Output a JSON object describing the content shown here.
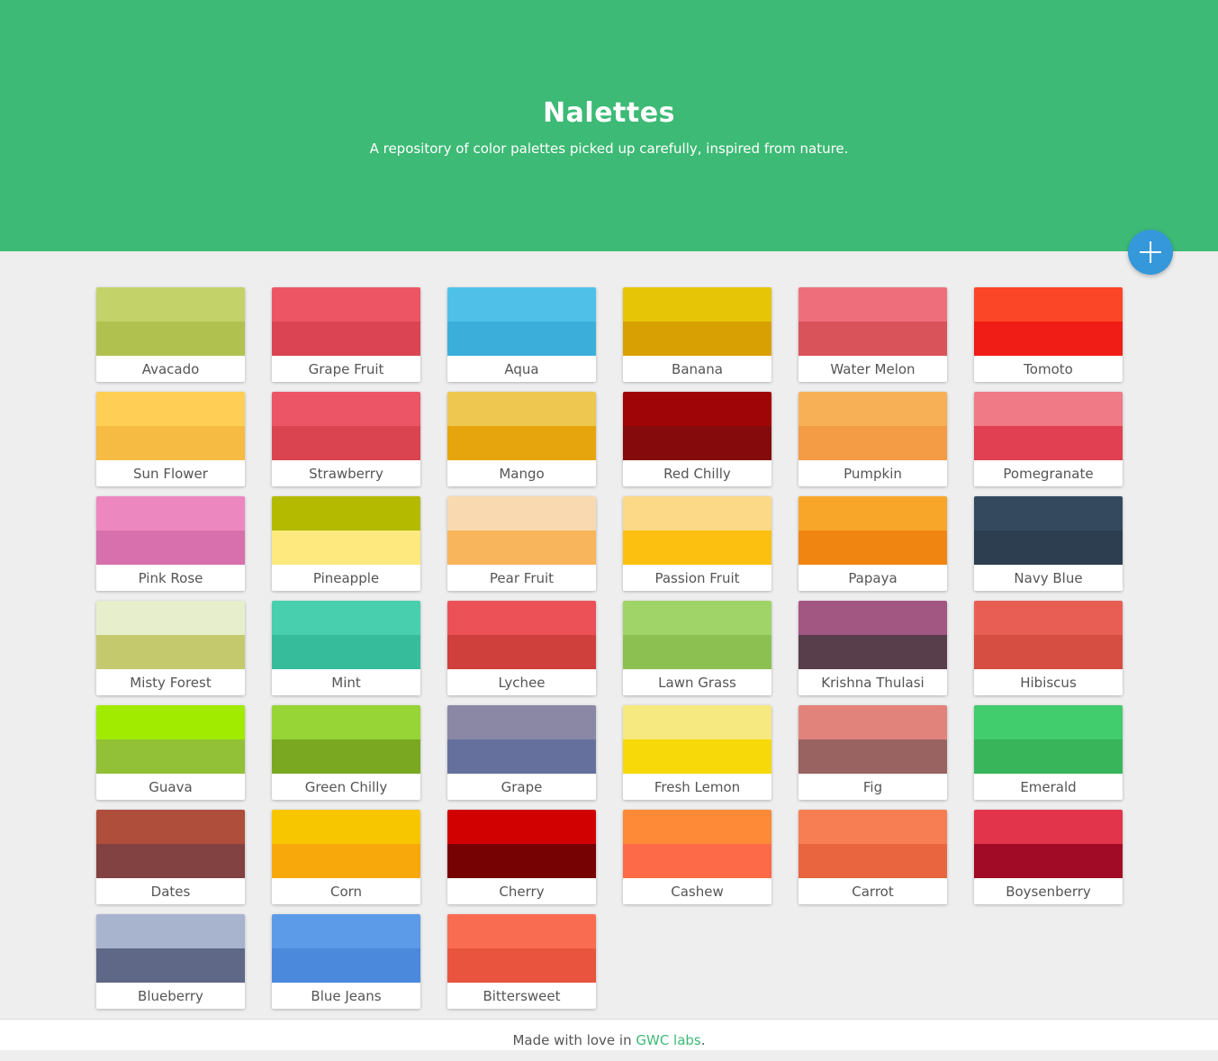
{
  "header": {
    "title": "Nalettes",
    "subtitle": "A repository of color palettes picked up carefully, inspired from nature."
  },
  "colors": {
    "header_bg": "#3dba75",
    "fab_bg": "#3498db",
    "page_bg": "#eeeeee"
  },
  "fab": {
    "icon": "plus-icon"
  },
  "palettes": [
    {
      "name": "Avacado",
      "top": "#c3d369",
      "bottom": "#b1c150"
    },
    {
      "name": "Grape Fruit",
      "top": "#ed5565",
      "bottom": "#da4453"
    },
    {
      "name": "Aqua",
      "top": "#4fc1e9",
      "bottom": "#3bafda"
    },
    {
      "name": "Banana",
      "top": "#e5c505",
      "bottom": "#d9a004"
    },
    {
      "name": "Water Melon",
      "top": "#ee6f7b",
      "bottom": "#d9535a"
    },
    {
      "name": "Tomoto",
      "top": "#fc4628",
      "bottom": "#ef1d16"
    },
    {
      "name": "Sun Flower",
      "top": "#ffce54",
      "bottom": "#f6bb42"
    },
    {
      "name": "Strawberry",
      "top": "#ec5565",
      "bottom": "#da4450"
    },
    {
      "name": "Mango",
      "top": "#eec750",
      "bottom": "#e6a50c"
    },
    {
      "name": "Red Chilly",
      "top": "#9f0407",
      "bottom": "#840a0b"
    },
    {
      "name": "Pumpkin",
      "top": "#f8b057",
      "bottom": "#f39b45"
    },
    {
      "name": "Pomegranate",
      "top": "#f07a85",
      "bottom": "#e04052"
    },
    {
      "name": "Pink Rose",
      "top": "#ec87c0",
      "bottom": "#d770ad"
    },
    {
      "name": "Pineapple",
      "top": "#b3ba00",
      "bottom": "#fde97e"
    },
    {
      "name": "Pear Fruit",
      "top": "#f8d9b0",
      "bottom": "#f8b55c"
    },
    {
      "name": "Passion Fruit",
      "top": "#fbd987",
      "bottom": "#fcc010"
    },
    {
      "name": "Papaya",
      "top": "#f8a62a",
      "bottom": "#f18512"
    },
    {
      "name": "Navy Blue",
      "top": "#34495e",
      "bottom": "#2c3e50"
    },
    {
      "name": "Misty Forest",
      "top": "#e6eecc",
      "bottom": "#c5c96d"
    },
    {
      "name": "Mint",
      "top": "#48cfad",
      "bottom": "#37bc9b"
    },
    {
      "name": "Lychee",
      "top": "#ec5158",
      "bottom": "#cf3f3b"
    },
    {
      "name": "Lawn Grass",
      "top": "#a0d468",
      "bottom": "#8cc152"
    },
    {
      "name": "Krishna Thulasi",
      "top": "#a25682",
      "bottom": "#583d4b"
    },
    {
      "name": "Hibiscus",
      "top": "#e95e54",
      "bottom": "#d64d41"
    },
    {
      "name": "Guava",
      "top": "#a1eb00",
      "bottom": "#92c036"
    },
    {
      "name": "Green Chilly",
      "top": "#96d535",
      "bottom": "#7aa821"
    },
    {
      "name": "Grape",
      "top": "#8a88a4",
      "bottom": "#65709d"
    },
    {
      "name": "Fresh Lemon",
      "top": "#f6e97f",
      "bottom": "#f7d909"
    },
    {
      "name": "Fig",
      "top": "#e1837b",
      "bottom": "#986360"
    },
    {
      "name": "Emerald",
      "top": "#41cc6d",
      "bottom": "#38b55a"
    },
    {
      "name": "Dates",
      "top": "#af4e3b",
      "bottom": "#834242"
    },
    {
      "name": "Corn",
      "top": "#f7c600",
      "bottom": "#f8a80b"
    },
    {
      "name": "Cherry",
      "top": "#d20101",
      "bottom": "#760204"
    },
    {
      "name": "Cashew",
      "top": "#fe8a37",
      "bottom": "#fc6a47"
    },
    {
      "name": "Carrot",
      "top": "#f77e52",
      "bottom": "#e86540"
    },
    {
      "name": "Boysenberry",
      "top": "#e2344a",
      "bottom": "#a20b25"
    },
    {
      "name": "Blueberry",
      "top": "#a8b3ce",
      "bottom": "#5f6887"
    },
    {
      "name": "Blue Jeans",
      "top": "#5c9be8",
      "bottom": "#4a89dc"
    },
    {
      "name": "Bittersweet",
      "top": "#f96c51",
      "bottom": "#e8543e"
    }
  ],
  "footer": {
    "prefix": "Made with love in ",
    "link_text": "GWC labs",
    "suffix": "."
  }
}
